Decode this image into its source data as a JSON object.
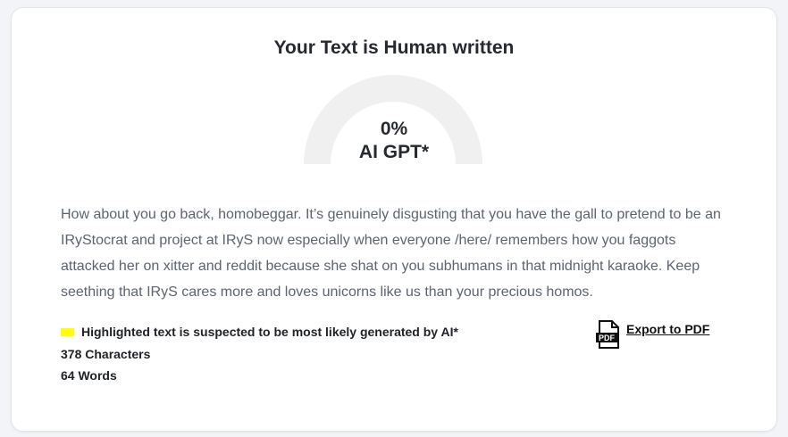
{
  "result": {
    "title": "Your Text is Human written",
    "gauge_value": "0%",
    "gauge_label": "AI GPT*",
    "ai_fraction": 0
  },
  "analyzed_text": "How about you go back, homobeggar. It’s genuinely disgusting that you have the gall to pretend to be an IRyStocrat and project at IRyS now especially when everyone /here/ remembers how you faggots attacked her on xitter and reddit because she shat on you subhumans in that midnight karaoke. Keep seething that IRyS cares more and loves unicorns like us than your precious homos.",
  "legend": {
    "text": "Highlighted text is suspected to be most likely generated by AI*",
    "highlight_color": "#ffff00"
  },
  "stats": {
    "characters": "378 Characters",
    "words": "64 Words"
  },
  "export": {
    "label": "Export to PDF",
    "icon": "pdf-file-icon",
    "icon_text": "PDF"
  },
  "colors": {
    "gauge_track": "#f0f0f0",
    "text": "#5c6470",
    "heading": "#262a30"
  }
}
